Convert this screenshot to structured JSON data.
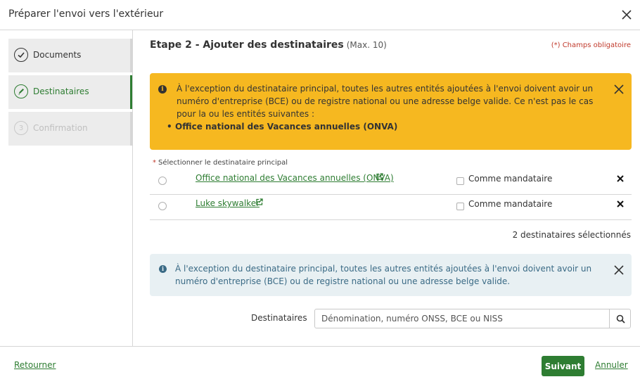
{
  "dialog": {
    "title": "Préparer l'envoi vers l'extérieur"
  },
  "steps": [
    {
      "number": "1",
      "label": "Documents",
      "state": "done",
      "icon": "check-icon"
    },
    {
      "number": "2",
      "label": "Destinataires",
      "state": "active",
      "icon": "pencil-icon"
    },
    {
      "number": "3",
      "label": "Confirmation",
      "state": "disabled"
    }
  ],
  "main": {
    "step_title": "Etape 2 - Ajouter des destinataires",
    "step_max": "(Max. 10)",
    "required_note": "(*) Champs obligatoire"
  },
  "alert_warning": {
    "text": "À l'exception du destinataire principal, toutes les autres entités ajoutées à l'envoi doivent avoir un numéro d'entreprise (BCE) ou de registre national ou une adresse belge valide. Ce n'est pas le cas pour la ou les entités suivantes :",
    "items": [
      "Office national des Vacances annuelles (ONVA)"
    ],
    "color": "#f6b820"
  },
  "recipients": {
    "select_label": "Sélectionner le destinataire principal",
    "required_marker": "*",
    "rows": [
      {
        "name": "Office national des Vacances annuelles (ONVA)",
        "proxy_label": "Comme mandataire"
      },
      {
        "name": "Luke skywalker",
        "proxy_label": "Comme mandataire"
      }
    ],
    "count_text": "2 destinataires sélectionnés"
  },
  "alert_info": {
    "text": "À l'exception du destinataire principal, toutes les autres entités ajoutées à l'envoi doivent avoir un numéro d'entreprise (BCE) ou de registre national ou une adresse belge valide.",
    "color": "#e8f0f3"
  },
  "search": {
    "label": "Destinataires",
    "placeholder": "Dénomination, numéro ONSS, BCE ou NISS"
  },
  "footer": {
    "back_label": "Retourner",
    "next_label": "Suivant",
    "cancel_label": "Annuler"
  },
  "colors": {
    "accent": "#2e7d32",
    "required": "#c0392b"
  }
}
